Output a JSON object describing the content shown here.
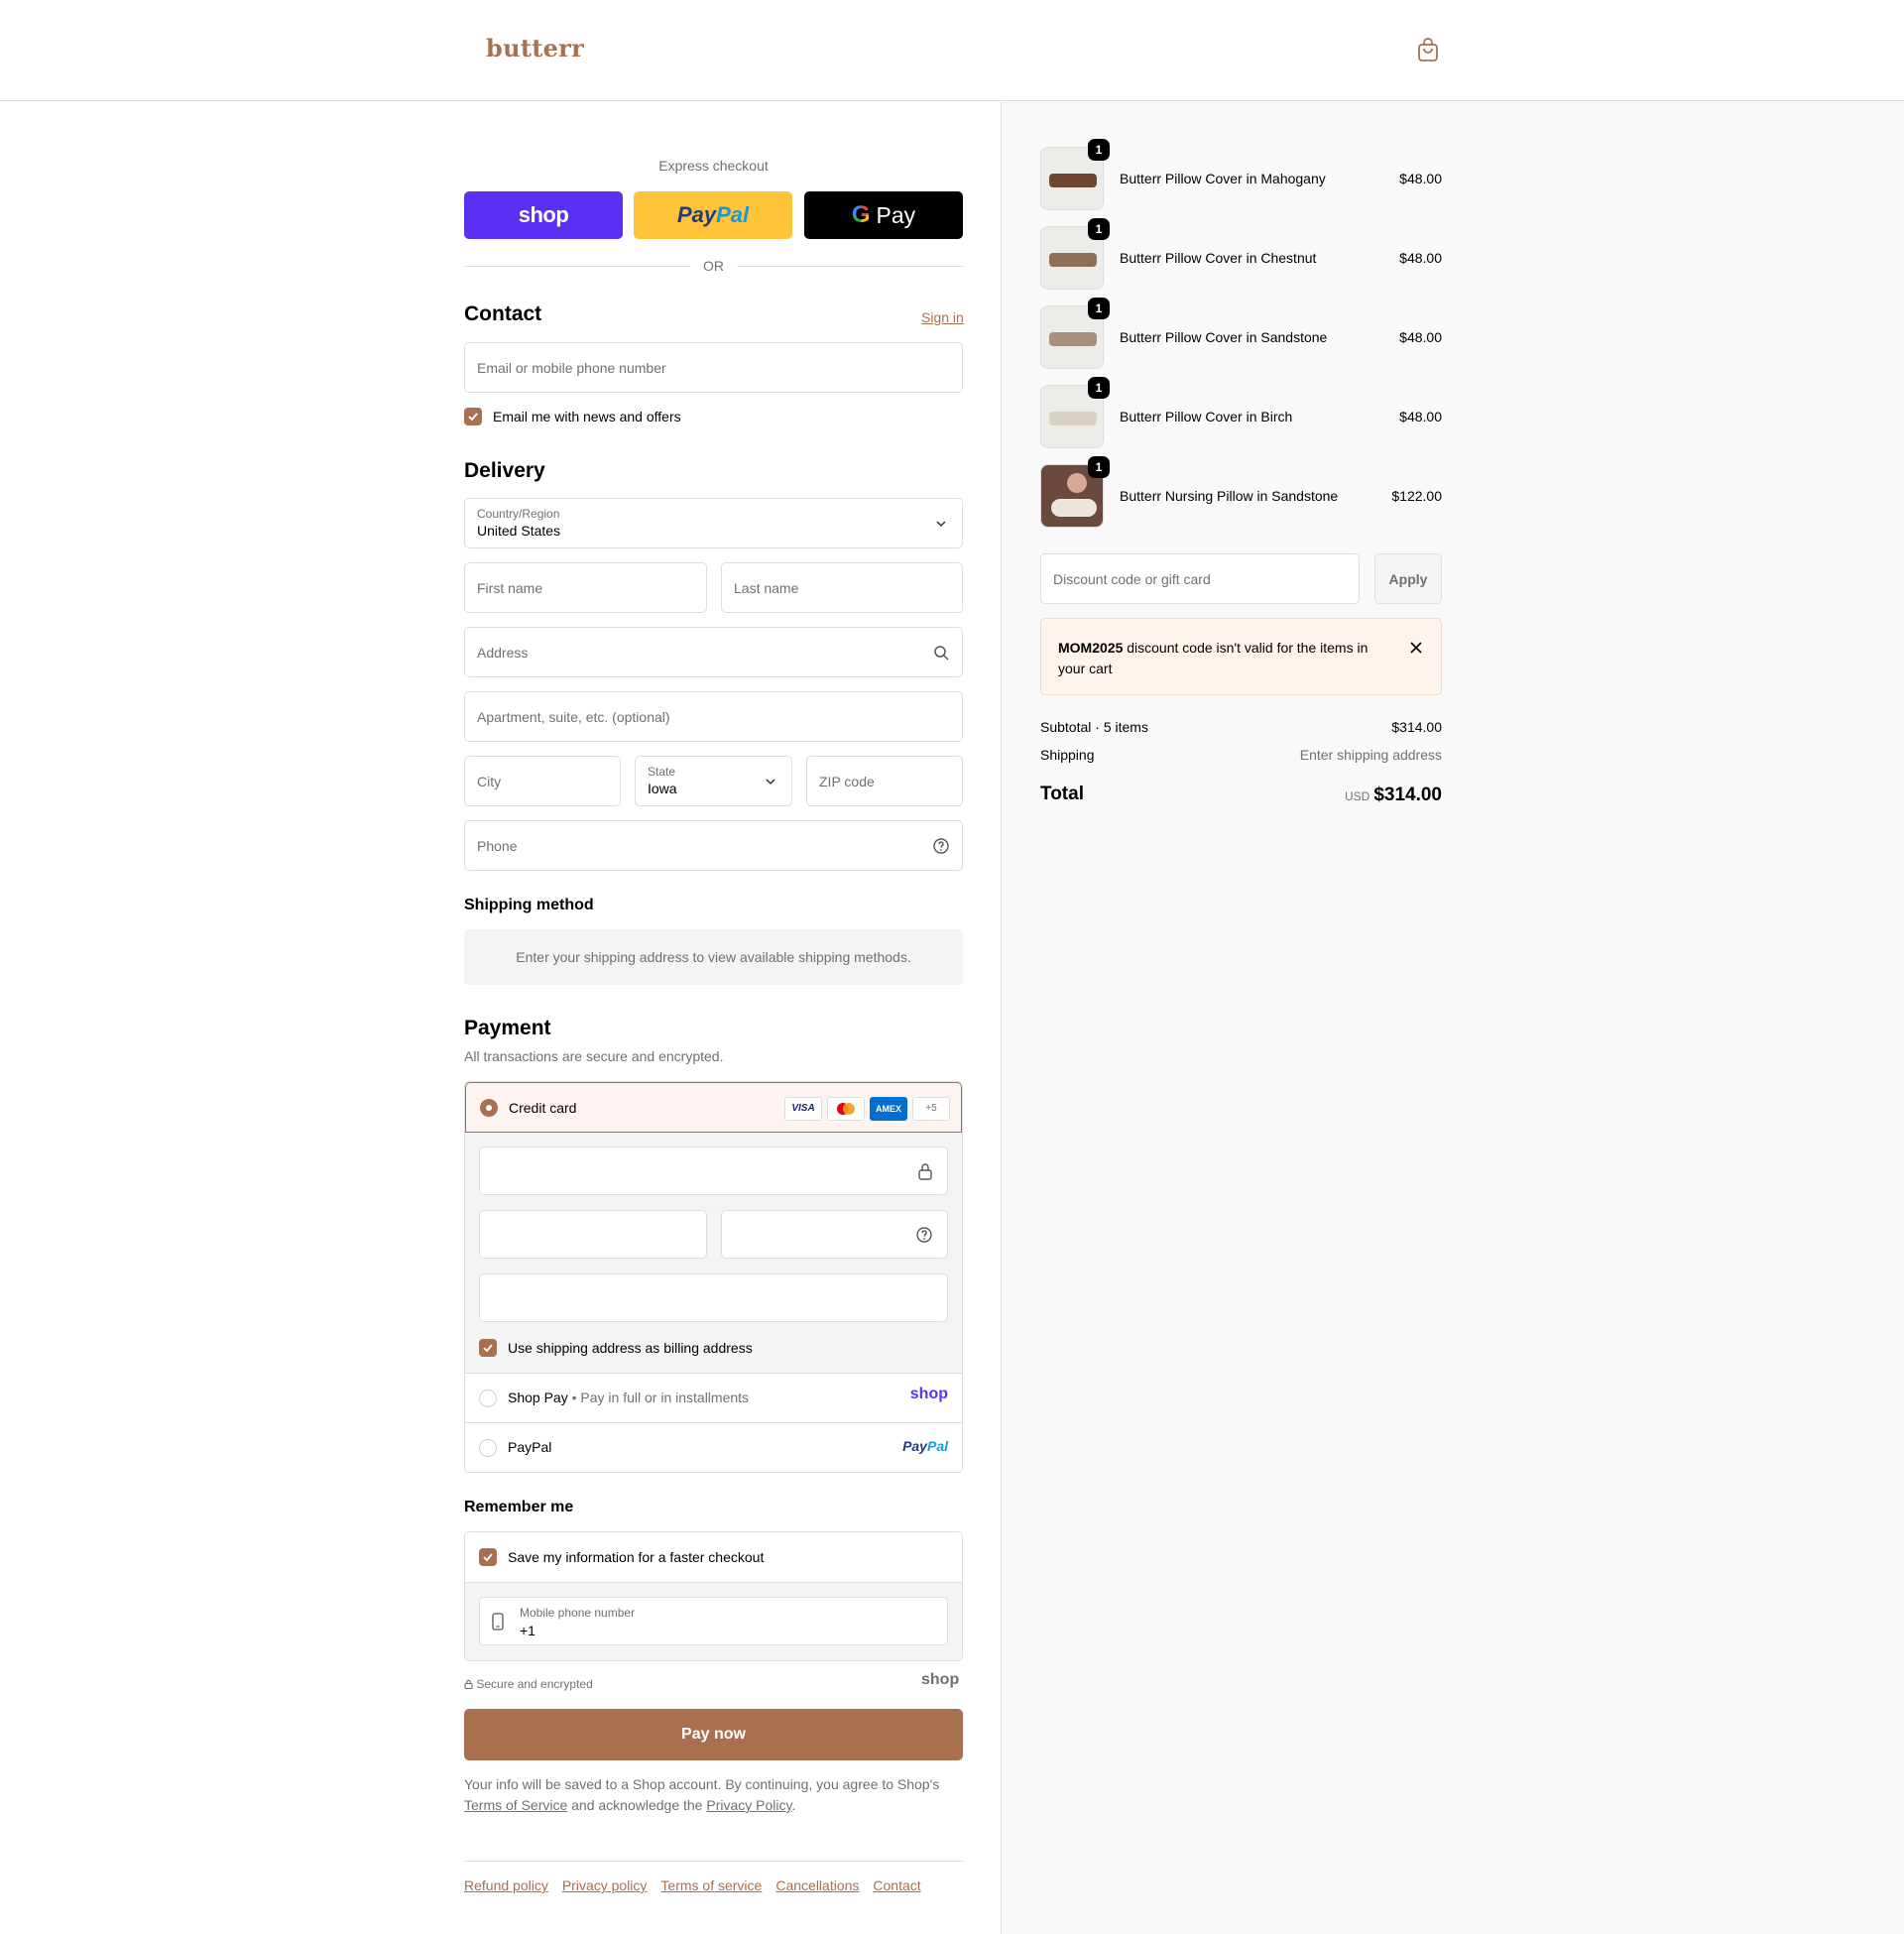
{
  "header": {
    "logo": "butterr",
    "cart_icon": "shopping-bag-icon"
  },
  "express": {
    "label": "Express checkout",
    "shop_label": "shop",
    "paypal_label_1": "Pay",
    "paypal_label_2": "Pal",
    "gpay_g": "G",
    "gpay_label": "Pay",
    "or_label": "OR"
  },
  "contact": {
    "title": "Contact",
    "sign_in": "Sign in",
    "email_placeholder": "Email or mobile phone number",
    "news_label": "Email me with news and offers",
    "news_checked": true
  },
  "delivery": {
    "title": "Delivery",
    "country_label": "Country/Region",
    "country_value": "United States",
    "first_name_placeholder": "First name",
    "last_name_placeholder": "Last name",
    "address_placeholder": "Address",
    "apartment_placeholder": "Apartment, suite, etc. (optional)",
    "city_placeholder": "City",
    "state_label": "State",
    "state_value": "Iowa",
    "zip_placeholder": "ZIP code",
    "phone_placeholder": "Phone"
  },
  "shipping_method": {
    "title": "Shipping method",
    "message": "Enter your shipping address to view available shipping methods."
  },
  "payment": {
    "title": "Payment",
    "subtitle": "All transactions are secure and encrypted.",
    "credit_card_label": "Credit card",
    "card_icons": [
      "VISA",
      "mastercard",
      "AMEX",
      "+5"
    ],
    "billing_label": "Use shipping address as billing address",
    "billing_checked": true,
    "shop_pay_label": "Shop Pay",
    "shop_pay_sub": "Pay in full or in installments",
    "shop_pay_logo": "shop",
    "paypal_label": "PayPal",
    "paypal_logo_1": "Pay",
    "paypal_logo_2": "Pal"
  },
  "remember": {
    "title": "Remember me",
    "save_label": "Save my information for a faster checkout",
    "save_checked": true,
    "mobile_label": "Mobile phone number",
    "mobile_value": "+1",
    "secure_label": "Secure and encrypted",
    "shop_logo": "shop"
  },
  "pay_now": "Pay now",
  "legal": {
    "text_1": "Your info will be saved to a Shop account. By continuing, you agree to Shop's",
    "terms": "Terms of Service",
    "text_2": "and acknowledge the",
    "privacy": "Privacy Policy",
    "text_3": "."
  },
  "footer": [
    "Refund policy",
    "Privacy policy",
    "Terms of service",
    "Cancellations",
    "Contact"
  ],
  "summary": {
    "items": [
      {
        "name": "Butterr Pillow Cover in Mahogany",
        "price": "$48.00",
        "qty": "1",
        "color": "#6e4632"
      },
      {
        "name": "Butterr Pillow Cover in Chestnut",
        "price": "$48.00",
        "qty": "1",
        "color": "#8e6f58"
      },
      {
        "name": "Butterr Pillow Cover in Sandstone",
        "price": "$48.00",
        "qty": "1",
        "color": "#a89080"
      },
      {
        "name": "Butterr Pillow Cover in Birch",
        "price": "$48.00",
        "qty": "1",
        "color": "#d8d2c4"
      },
      {
        "name": "Butterr Nursing Pillow in Sandstone",
        "price": "$122.00",
        "qty": "1",
        "color": "#b48a7a"
      }
    ],
    "discount_placeholder": "Discount code or gift card",
    "apply_label": "Apply",
    "notice_code": "MOM2025",
    "notice_text": "discount code isn't valid for the items in your cart",
    "subtotal_label": "Subtotal · 5 items",
    "subtotal_value": "$314.00",
    "shipping_label": "Shipping",
    "shipping_value": "Enter shipping address",
    "total_label": "Total",
    "total_currency": "USD",
    "total_value": "$314.00"
  }
}
